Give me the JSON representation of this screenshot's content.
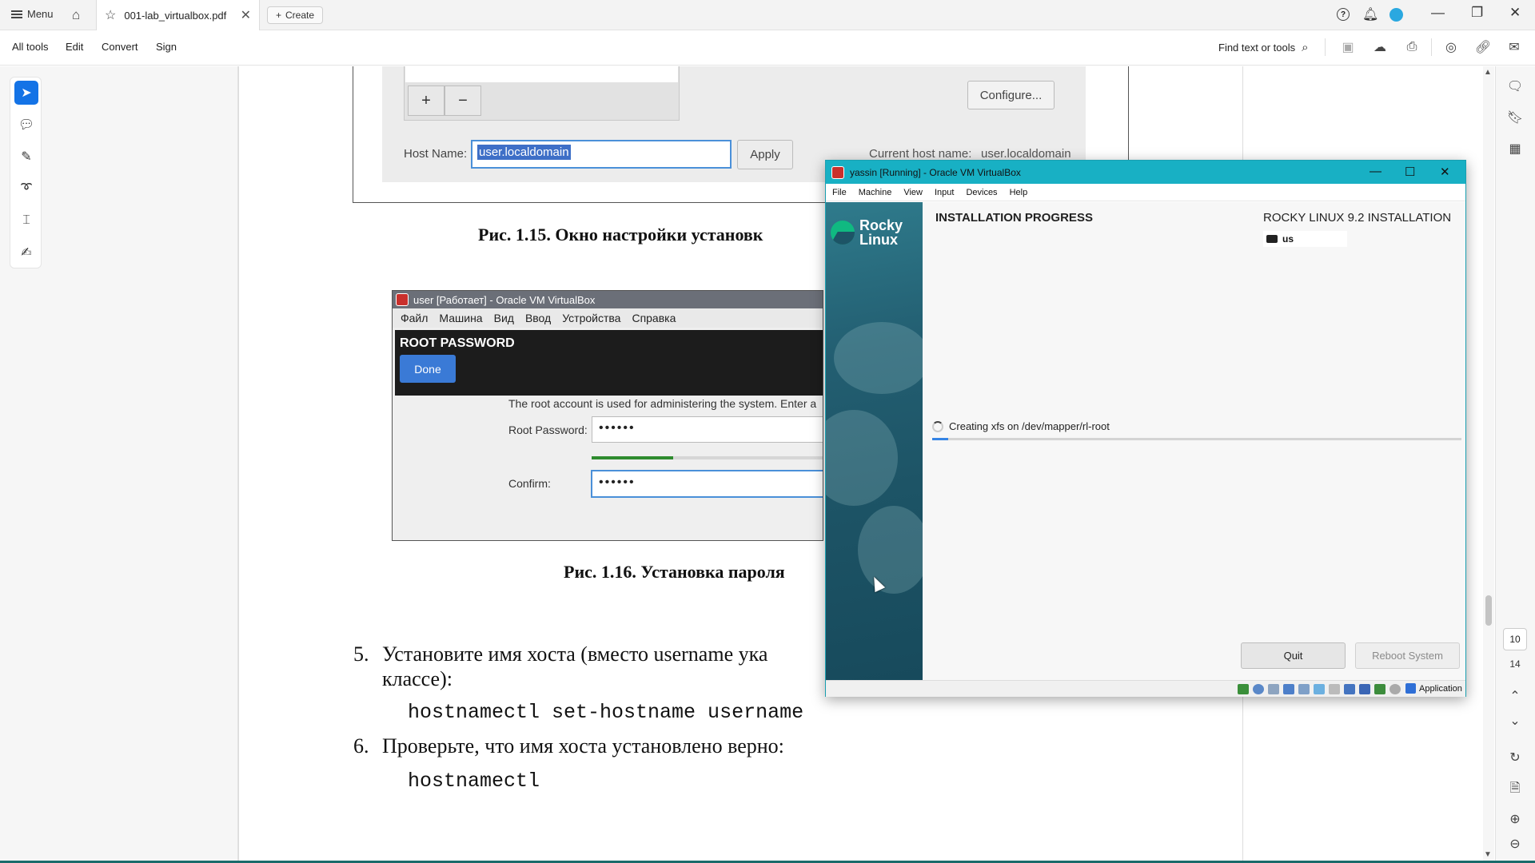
{
  "app": {
    "menu_label": "Menu",
    "tab_title": "001-lab_virtualbox.pdf",
    "create_label": "Create"
  },
  "toolbar": {
    "items": [
      "All tools",
      "Edit",
      "Convert",
      "Sign"
    ],
    "find_label": "Find text or tools"
  },
  "page_nav": {
    "current": "10",
    "total": "14"
  },
  "doc": {
    "fig15": {
      "configure_label": "Configure...",
      "host_name_label": "Host Name:",
      "host_name_value": "user.localdomain",
      "apply_label": "Apply",
      "current_host_label": "Current host name:",
      "current_host_value": "user.localdomain",
      "caption": "Рис. 1.15. Окно настройки установк"
    },
    "fig16": {
      "title": "user [Работает] - Oracle VM VirtualBox",
      "menu": [
        "Файл",
        "Машина",
        "Вид",
        "Ввод",
        "Устройства",
        "Справка"
      ],
      "section_title": "ROOT PASSWORD",
      "done_label": "Done",
      "description": "The root account is used for administering the system.  Enter a",
      "root_password_label": "Root Password:",
      "root_password_value": "••••••",
      "password_strength": 0.34,
      "confirm_label": "Confirm:",
      "confirm_value": "••••••",
      "caption": "Рис. 1.16. Установка пароля"
    },
    "steps": [
      {
        "num": "5.",
        "text": "Установите имя хоста (вместо username ука",
        "cont": "классе):",
        "code": "hostnamectl  set-hostname  username"
      },
      {
        "num": "6.",
        "text": "Проверьте, что имя хоста установлено верно:",
        "code": "hostnamectl"
      }
    ]
  },
  "vbox": {
    "title": "yassin [Running] - Oracle VM VirtualBox",
    "menu": [
      "File",
      "Machine",
      "View",
      "Input",
      "Devices",
      "Help"
    ],
    "logo_text": [
      "Rocky",
      "Linux"
    ],
    "heading": "INSTALLATION PROGRESS",
    "product": "ROCKY LINUX 9.2 INSTALLATION",
    "keyboard": "us",
    "progress_text": "Creating xfs on /dev/mapper/rl-root",
    "progress": 0.03,
    "quit_label": "Quit",
    "reboot_label": "Reboot System",
    "host_key": "Application"
  }
}
